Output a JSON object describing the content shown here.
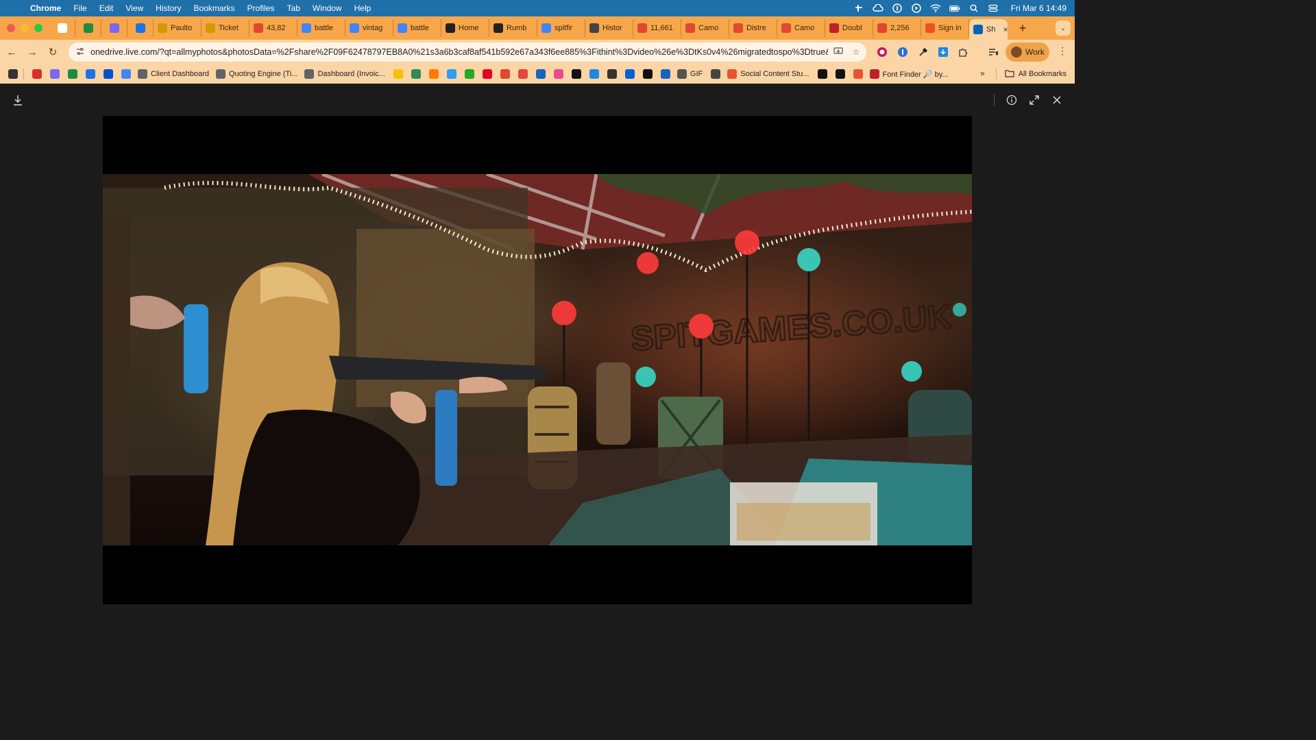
{
  "menubar": {
    "app_name": "Chrome",
    "items": [
      "File",
      "Edit",
      "View",
      "History",
      "Bookmarks",
      "Profiles",
      "Tab",
      "Window",
      "Help"
    ],
    "clock": "Fri Mar 6  14:49"
  },
  "tabs": [
    {
      "label": "",
      "icon": "gmail-icon",
      "color": "#ffffff",
      "pinned": true
    },
    {
      "label": "",
      "icon": "sheets-icon",
      "color": "#1e8e3e",
      "pinned": true
    },
    {
      "label": "",
      "icon": "clickup-icon",
      "color": "#7b68ee",
      "pinned": true
    },
    {
      "label": "",
      "icon": "calendar-icon",
      "color": "#1a73e8",
      "pinned": true
    },
    {
      "label": "Paulto",
      "icon": "star-icon",
      "color": "#d19a00"
    },
    {
      "label": "Ticket",
      "icon": "star-icon",
      "color": "#d19a00"
    },
    {
      "label": "43,82",
      "icon": "shopify-icon",
      "color": "#e0492f"
    },
    {
      "label": "battle",
      "icon": "google-icon",
      "color": "#4285f4"
    },
    {
      "label": "vintag",
      "icon": "google-icon",
      "color": "#4285f4"
    },
    {
      "label": "battle",
      "icon": "google-icon",
      "color": "#4285f4"
    },
    {
      "label": "Home",
      "icon": "home-icon",
      "color": "#222222"
    },
    {
      "label": "Rumb",
      "icon": "rumble-icon",
      "color": "#222222"
    },
    {
      "label": "spitfir",
      "icon": "google-icon",
      "color": "#4285f4"
    },
    {
      "label": "Histor",
      "icon": "openai-icon",
      "color": "#444444"
    },
    {
      "label": "11,661",
      "icon": "shopify-icon",
      "color": "#e0492f"
    },
    {
      "label": "Camo",
      "icon": "shopify-icon",
      "color": "#e0492f"
    },
    {
      "label": "Distre",
      "icon": "shopify-icon",
      "color": "#e0492f"
    },
    {
      "label": "Camo",
      "icon": "shopify-icon",
      "color": "#e0492f"
    },
    {
      "label": "Doubl",
      "icon": "square-icon",
      "color": "#c0202a"
    },
    {
      "label": "2,256",
      "icon": "shopify-icon",
      "color": "#e0492f"
    },
    {
      "label": "Sign in",
      "icon": "microsoft-icon",
      "color": "#f25022"
    },
    {
      "label": "Sh",
      "icon": "onedrive-icon",
      "color": "#0364b8",
      "active": true
    }
  ],
  "toolbar": {
    "url": "onedrive.live.com/?qt=allmyphotos&photosData=%2Fshare%2F09F62478797EB8A0%21s3a6b3caf8af541b592e67a343f6ee885%3Fithint%3Dvideo%26e%3DtKs0v4%26migratedtospo%3Dtrue&c...",
    "profile_label": "Work"
  },
  "bookmarks": [
    {
      "label": "",
      "icon": "apps-grid-icon",
      "color": "#333333"
    },
    {
      "label": "",
      "icon": "gmail-icon",
      "color": "#d93025"
    },
    {
      "label": "",
      "icon": "clickup-icon",
      "color": "#7b68ee"
    },
    {
      "label": "",
      "icon": "sheets-icon",
      "color": "#1e8e3e"
    },
    {
      "label": "",
      "icon": "calendar-icon",
      "color": "#1a73e8"
    },
    {
      "label": "",
      "icon": "trello-icon",
      "color": "#0052cc"
    },
    {
      "label": "",
      "icon": "google-icon",
      "color": "#4285f4"
    },
    {
      "label": "Client Dashboard",
      "icon": "link-icon",
      "color": "#5f6368"
    },
    {
      "label": "Quoting Engine (Ti...",
      "icon": "link-icon",
      "color": "#5f6368"
    },
    {
      "label": "Dashboard (Invoic...",
      "icon": "link-icon",
      "color": "#5f6368"
    },
    {
      "label": "",
      "icon": "mailchimp-icon",
      "color": "#f5c400"
    },
    {
      "label": "",
      "icon": "b-icon",
      "color": "#2e8b57"
    },
    {
      "label": "",
      "icon": "gear-icon",
      "color": "#ff7a00"
    },
    {
      "label": "",
      "icon": "globe-icon",
      "color": "#2a9df4"
    },
    {
      "label": "",
      "icon": "bolt-icon",
      "color": "#22aa22"
    },
    {
      "label": "",
      "icon": "pinterest-icon",
      "color": "#e60023"
    },
    {
      "label": "",
      "icon": "shopify-icon",
      "color": "#e0492f"
    },
    {
      "label": "",
      "icon": "mail-icon",
      "color": "#e2483d"
    },
    {
      "label": "",
      "icon": "chart-icon",
      "color": "#1565c0"
    },
    {
      "label": "",
      "icon": "dribbble-icon",
      "color": "#ea4c89"
    },
    {
      "label": "",
      "icon": "s-icon",
      "color": "#111111"
    },
    {
      "label": "",
      "icon": "c-icon",
      "color": "#1e88e5"
    },
    {
      "label": "",
      "icon": "m-icon",
      "color": "#333333"
    },
    {
      "label": "",
      "icon": "box-icon",
      "color": "#0061d5"
    },
    {
      "label": "",
      "icon": "f-icon",
      "color": "#111111"
    },
    {
      "label": "",
      "icon": "flag-icon",
      "color": "#1565c0"
    },
    {
      "label": "GIF",
      "icon": "gif-icon",
      "color": "#555555"
    },
    {
      "label": "",
      "icon": "openai-icon",
      "color": "#444444"
    },
    {
      "label": "Social Content Stu...",
      "icon": "spark-icon",
      "color": "#e8542f"
    },
    {
      "label": "",
      "icon": "circle-icon",
      "color": "#111111"
    },
    {
      "label": "",
      "icon": "notion-icon",
      "color": "#111111"
    },
    {
      "label": "",
      "icon": "t-icon",
      "color": "#e8542f"
    },
    {
      "label": "Font Finder 🔎 by...",
      "icon": "font-icon",
      "color": "#c0202a"
    }
  ],
  "bookmarks_more": "»",
  "all_bookmarks_label": "All Bookmarks",
  "scene": {
    "sign_text": "SPITGAMES.CO.UK"
  }
}
